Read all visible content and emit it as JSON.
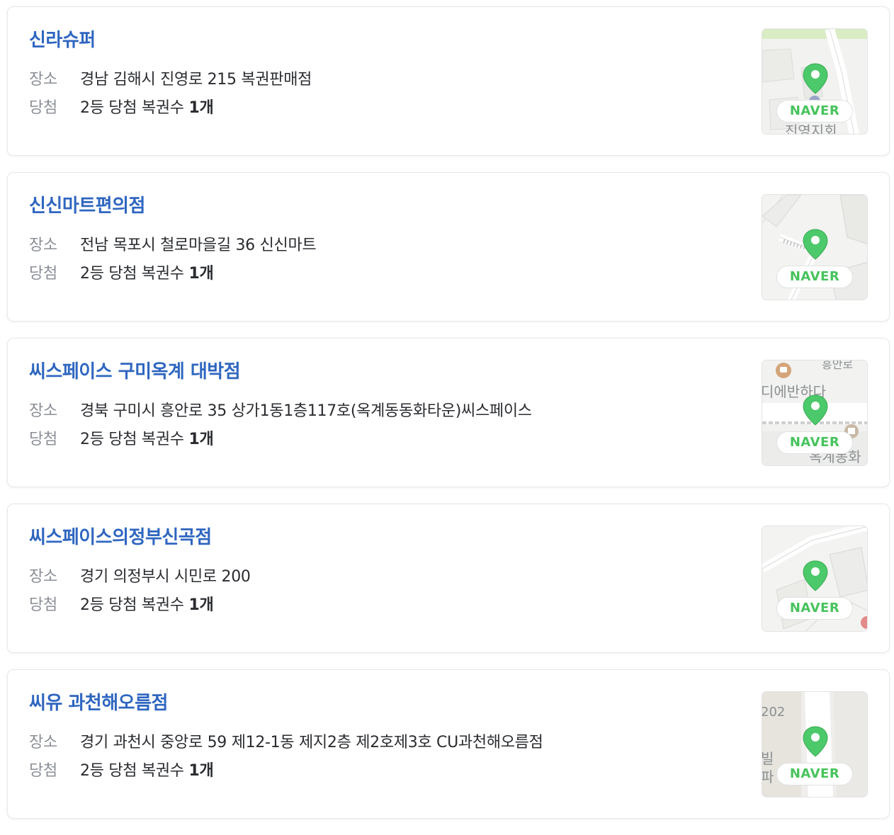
{
  "labels": {
    "place": "장소",
    "win": "당첨",
    "map_badge": "NAVER"
  },
  "stores": [
    {
      "name": "신라슈퍼",
      "address": "경남 김해시 진영로 215 복권판매점",
      "win_text": "2등 당첨 복권수",
      "win_count": "1개",
      "map_texts": [
        "진영지회"
      ]
    },
    {
      "name": "신신마트편의점",
      "address": "전남 목포시 철로마을길 36 신신마트",
      "win_text": "2등 당첨 복권수",
      "win_count": "1개",
      "map_texts": []
    },
    {
      "name": "씨스페이스 구미옥계 대박점",
      "address": "경북 구미시 흥안로 35 상가1동1층117호(옥계동동화타운)씨스페이스",
      "win_text": "2등 당첨 복권수",
      "win_count": "1개",
      "map_texts": [
        "디에반하다",
        "옥계동화",
        "흥안로"
      ]
    },
    {
      "name": "씨스페이스의정부신곡점",
      "address": "경기 의정부시 시민로 200",
      "win_text": "2등 당첨 복권수",
      "win_count": "1개",
      "map_texts": []
    },
    {
      "name": "씨유 과천해오름점",
      "address": "경기 과천시 중앙로 59 제12-1동 제지2층 제2호제3호 CU과천해오름점",
      "win_text": "2등 당첨 복권수",
      "win_count": "1개",
      "map_texts": [
        "202",
        "빌",
        "파"
      ]
    }
  ],
  "colors": {
    "store_name": "#2f66c0",
    "label": "#8b8f96",
    "value": "#2a2c30",
    "naver_green": "#47c35c",
    "pin_green": "#4cc96a"
  }
}
